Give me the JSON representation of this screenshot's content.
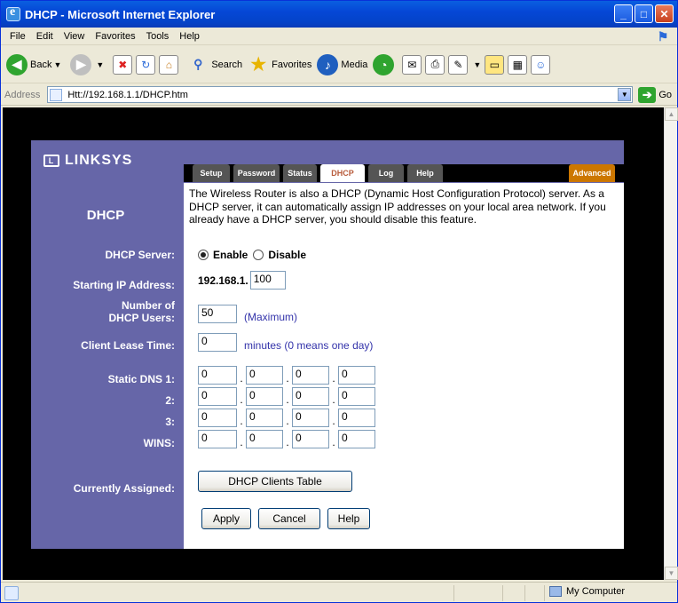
{
  "window": {
    "title": "DHCP - Microsoft Internet Explorer"
  },
  "menu": {
    "file": "File",
    "edit": "Edit",
    "view": "View",
    "favorites": "Favorites",
    "tools": "Tools",
    "help": "Help"
  },
  "toolbar": {
    "back": "Back",
    "search": "Search",
    "favorites": "Favorites",
    "media": "Media"
  },
  "address": {
    "label": "Address",
    "url": "Htt://192.168.1.1/DHCP.htm",
    "go": "Go"
  },
  "status": {
    "zone": "My Computer"
  },
  "brand": {
    "logo": "LINKSYS"
  },
  "tabs": [
    {
      "label": "Setup"
    },
    {
      "label": "Password"
    },
    {
      "label": "Status"
    },
    {
      "label": "DHCP"
    },
    {
      "label": "Log"
    },
    {
      "label": "Help"
    },
    {
      "label": "Advanced"
    }
  ],
  "page": {
    "title": "DHCP",
    "description": "The Wireless Router is also a DHCP (Dynamic Host Configuration Protocol) server. As a DHCP server, it can automatically assign IP addresses on your local area network. If you already have a DHCP server, you should disable this feature."
  },
  "labels": {
    "dhcp_server": "DHCP Server:",
    "starting_ip": "Starting IP Address:",
    "num_users_1": "Number of",
    "num_users_2": "DHCP Users:",
    "lease_time": "Client Lease Time:",
    "dns1": "Static DNS 1:",
    "dns2": "2:",
    "dns3": "3:",
    "wins": "WINS:",
    "assigned": "Currently Assigned:"
  },
  "form": {
    "enable": "Enable",
    "disable": "Disable",
    "ip_prefix": "192.168.1.",
    "ip_last": "100",
    "num_users": "50",
    "num_users_note": "(Maximum)",
    "lease": "0",
    "lease_note": "minutes (0 means one day)",
    "dns1": [
      "0",
      "0",
      "0",
      "0"
    ],
    "dns2": [
      "0",
      "0",
      "0",
      "0"
    ],
    "dns3": [
      "0",
      "0",
      "0",
      "0"
    ],
    "wins": [
      "0",
      "0",
      "0",
      "0"
    ]
  },
  "buttons": {
    "clients_table": "DHCP Clients Table",
    "apply": "Apply",
    "cancel": "Cancel",
    "help": "Help"
  }
}
